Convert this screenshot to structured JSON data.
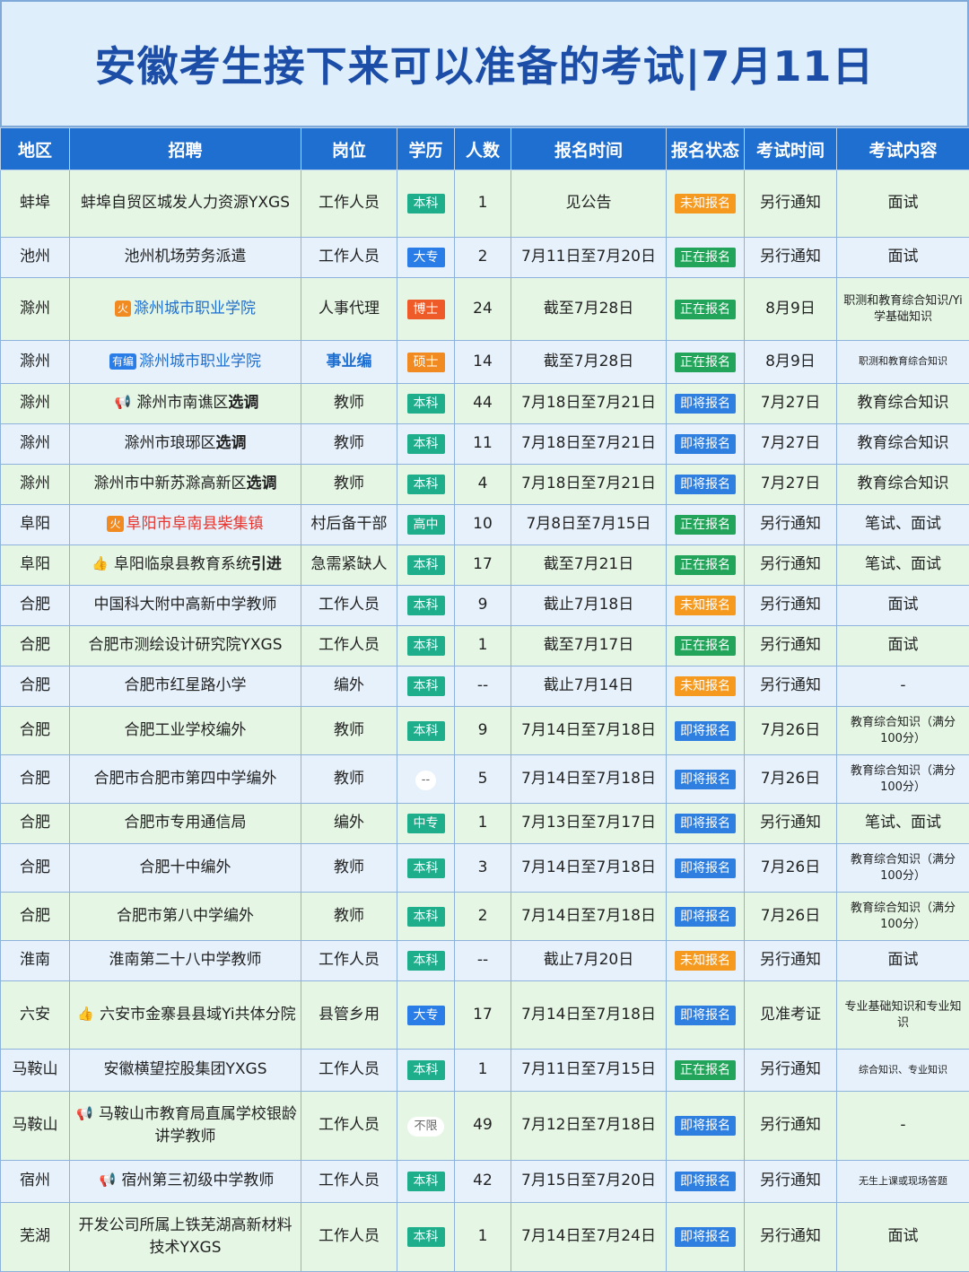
{
  "title": "安徽考生接下来可以准备的考试|7月11日",
  "headers": [
    "地区",
    "招聘",
    "岗位",
    "学历",
    "人数",
    "报名时间",
    "报名状态",
    "考试时间",
    "考试内容"
  ],
  "colors": {
    "header_bg": "#1f6fd0",
    "row_green": "#e5f6e4",
    "row_blue": "#e6f1fb",
    "status_unknown": "#f59a1f",
    "status_open": "#22a55a",
    "status_soon": "#2f7fe0",
    "edu_green": "#1fae8c",
    "edu_blue": "#2a7ce6",
    "edu_orange": "#f28a22",
    "edu_red": "#ee5b28"
  },
  "rows": [
    {
      "region": "蚌埠",
      "name": "蚌埠自贸区城发人力资源YXGS",
      "pos": "工作人员",
      "edu": "本科",
      "edu_color": "#1fae8c",
      "num": "1",
      "reg": "见公告",
      "status": "未知报名",
      "status_color": "#f59a1f",
      "exam": "另行通知",
      "content": "面试",
      "h": 75
    },
    {
      "region": "池州",
      "name": "池州机场劳务派遣",
      "pos": "工作人员",
      "edu": "大专",
      "edu_color": "#2a7ce6",
      "num": "2",
      "reg": "7月11日至7月20日",
      "status": "正在报名",
      "status_color": "#22a55a",
      "exam": "另行通知",
      "content": "面试",
      "h": 45
    },
    {
      "region": "滁州",
      "icon": "火",
      "icon_color": "#f28a22",
      "name": "滁州城市职业学院",
      "name_style": "blue",
      "pos": "人事代理",
      "edu": "博士",
      "edu_color": "#ee5b28",
      "num": "24",
      "reg": "截至7月28日",
      "status": "正在报名",
      "status_color": "#22a55a",
      "exam": "8月9日",
      "content": "职测和教育综合知识/Yi学基础知识",
      "content_size": "small",
      "h": 70
    },
    {
      "region": "滁州",
      "icon": "有编",
      "icon_color": "#2a7ce6",
      "name": "滁州城市职业学院",
      "name_style": "blue",
      "pos": "事业编",
      "pos_style": "bluebold",
      "edu": "硕士",
      "edu_color": "#f28a22",
      "num": "14",
      "reg": "截至7月28日",
      "status": "正在报名",
      "status_color": "#22a55a",
      "exam": "8月9日",
      "content": "职测和教育综合知识",
      "content_size": "tiny",
      "h": 48
    },
    {
      "region": "滁州",
      "icon": "📢",
      "name": "滁州市南谯区",
      "name_bold": "选调",
      "pos": "教师",
      "edu": "本科",
      "edu_color": "#1fae8c",
      "num": "44",
      "reg": "7月18日至7月21日",
      "status": "即将报名",
      "status_color": "#2f7fe0",
      "exam": "7月27日",
      "content": "教育综合知识",
      "h": 45
    },
    {
      "region": "滁州",
      "name": "滁州市琅琊区",
      "name_bold": "选调",
      "pos": "教师",
      "edu": "本科",
      "edu_color": "#1fae8c",
      "num": "11",
      "reg": "7月18日至7月21日",
      "status": "即将报名",
      "status_color": "#2f7fe0",
      "exam": "7月27日",
      "content": "教育综合知识",
      "h": 45
    },
    {
      "region": "滁州",
      "name": "滁州市中新苏滁高新区",
      "name_bold": "选调",
      "pos": "教师",
      "edu": "本科",
      "edu_color": "#1fae8c",
      "num": "4",
      "reg": "7月18日至7月21日",
      "status": "即将报名",
      "status_color": "#2f7fe0",
      "exam": "7月27日",
      "content": "教育综合知识",
      "h": 45
    },
    {
      "region": "阜阳",
      "icon": "火",
      "icon_color": "#f28a22",
      "name": "阜阳市阜南县柴集镇",
      "name_style": "red",
      "pos": "村后备干部",
      "edu": "高中",
      "edu_color": "#1fae8c",
      "num": "10",
      "reg": "7月8日至7月15日",
      "status": "正在报名",
      "status_color": "#22a55a",
      "exam": "另行通知",
      "content": "笔试、面试",
      "h": 45
    },
    {
      "region": "阜阳",
      "icon": "👍",
      "name": "阜阳临泉县教育系统",
      "name_bold": "引进",
      "pos": "急需紧缺人",
      "edu": "本科",
      "edu_color": "#1fae8c",
      "num": "17",
      "reg": "截至7月21日",
      "status": "正在报名",
      "status_color": "#22a55a",
      "exam": "另行通知",
      "content": "笔试、面试",
      "h": 45
    },
    {
      "region": "合肥",
      "name": "中国科大附中高新中学教师",
      "pos": "工作人员",
      "edu": "本科",
      "edu_color": "#1fae8c",
      "num": "9",
      "reg": "截止7月18日",
      "status": "未知报名",
      "status_color": "#f59a1f",
      "exam": "另行通知",
      "content": "面试",
      "h": 45
    },
    {
      "region": "合肥",
      "name": "合肥市测绘设计研究院YXGS",
      "pos": "工作人员",
      "edu": "本科",
      "edu_color": "#1fae8c",
      "num": "1",
      "reg": "截至7月17日",
      "status": "正在报名",
      "status_color": "#22a55a",
      "exam": "另行通知",
      "content": "面试",
      "h": 45
    },
    {
      "region": "合肥",
      "name": "合肥市红星路小学",
      "pos": "编外",
      "edu": "本科",
      "edu_color": "#1fae8c",
      "num": "--",
      "reg": "截止7月14日",
      "status": "未知报名",
      "status_color": "#f59a1f",
      "exam": "另行通知",
      "content": "-",
      "h": 45
    },
    {
      "region": "合肥",
      "name": "合肥工业学校编外",
      "pos": "教师",
      "edu": "本科",
      "edu_color": "#1fae8c",
      "num": "9",
      "reg": "7月14日至7月18日",
      "status": "即将报名",
      "status_color": "#2f7fe0",
      "exam": "7月26日",
      "content": "教育综合知识（满分100分）",
      "content_size": "small",
      "h": 54
    },
    {
      "region": "合肥",
      "name": "合肥市合肥市第四中学编外",
      "pos": "教师",
      "edu": "--",
      "edu_color": "#ffffff",
      "num": "5",
      "reg": "7月14日至7月18日",
      "status": "即将报名",
      "status_color": "#2f7fe0",
      "exam": "7月26日",
      "content": "教育综合知识（满分100分）",
      "content_size": "small",
      "h": 54
    },
    {
      "region": "合肥",
      "name": "合肥市专用通信局",
      "pos": "编外",
      "edu": "中专",
      "edu_color": "#1fae8c",
      "num": "1",
      "reg": "7月13日至7月17日",
      "status": "即将报名",
      "status_color": "#2f7fe0",
      "exam": "另行通知",
      "content": "笔试、面试",
      "h": 45
    },
    {
      "region": "合肥",
      "name": "合肥十中编外",
      "pos": "教师",
      "edu": "本科",
      "edu_color": "#1fae8c",
      "num": "3",
      "reg": "7月14日至7月18日",
      "status": "即将报名",
      "status_color": "#2f7fe0",
      "exam": "7月26日",
      "content": "教育综合知识（满分100分）",
      "content_size": "small",
      "h": 54
    },
    {
      "region": "合肥",
      "name": "合肥市第八中学编外",
      "pos": "教师",
      "edu": "本科",
      "edu_color": "#1fae8c",
      "num": "2",
      "reg": "7月14日至7月18日",
      "status": "即将报名",
      "status_color": "#2f7fe0",
      "exam": "7月26日",
      "content": "教育综合知识（满分100分）",
      "content_size": "small",
      "h": 54
    },
    {
      "region": "淮南",
      "name": "淮南第二十八中学教师",
      "pos": "工作人员",
      "edu": "本科",
      "edu_color": "#1fae8c",
      "num": "--",
      "reg": "截止7月20日",
      "status": "未知报名",
      "status_color": "#f59a1f",
      "exam": "另行通知",
      "content": "面试",
      "h": 45
    },
    {
      "region": "六安",
      "icon": "👍",
      "name": "六安市金寨县县域Yi共体分院",
      "pos": "县管乡用",
      "edu": "大专",
      "edu_color": "#2a7ce6",
      "num": "17",
      "reg": "7月14日至7月18日",
      "status": "即将报名",
      "status_color": "#2f7fe0",
      "exam": "见准考证",
      "content": "专业基础知识和专业知识",
      "content_size": "small",
      "h": 76
    },
    {
      "region": "马鞍山",
      "name": "安徽横望控股集团YXGS",
      "pos": "工作人员",
      "edu": "本科",
      "edu_color": "#1fae8c",
      "num": "1",
      "reg": "7月11日至7月15日",
      "status": "正在报名",
      "status_color": "#22a55a",
      "exam": "另行通知",
      "content": "综合知识、专业知识",
      "content_size": "tiny",
      "h": 47
    },
    {
      "region": "马鞍山",
      "icon": "📢",
      "name": "马鞍山市教育局直属学校银龄讲学教师",
      "pos": "工作人员",
      "edu": "不限",
      "edu_color": "#ffffff",
      "num": "49",
      "reg": "7月12日至7月18日",
      "status": "即将报名",
      "status_color": "#2f7fe0",
      "exam": "另行通知",
      "content": "-",
      "h": 77
    },
    {
      "region": "宿州",
      "icon": "📢",
      "name": "宿州第三初级中学教师",
      "pos": "工作人员",
      "edu": "本科",
      "edu_color": "#1fae8c",
      "num": "42",
      "reg": "7月15日至7月20日",
      "status": "即将报名",
      "status_color": "#2f7fe0",
      "exam": "另行通知",
      "content": "无生上课或现场答题",
      "content_size": "tiny",
      "h": 47
    },
    {
      "region": "芜湖",
      "name": "开发公司所属上铁芜湖高新材料技术YXGS",
      "pos": "工作人员",
      "edu": "本科",
      "edu_color": "#1fae8c",
      "num": "1",
      "reg": "7月14日至7月24日",
      "status": "即将报名",
      "status_color": "#2f7fe0",
      "exam": "另行通知",
      "content": "面试",
      "h": 77
    }
  ]
}
